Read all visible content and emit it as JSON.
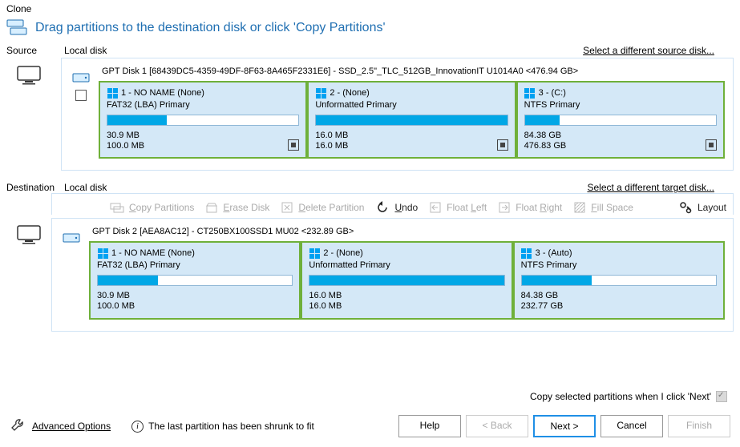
{
  "title": "Clone",
  "header": {
    "hint": "Drag partitions to the destination disk or click 'Copy Partitions'"
  },
  "source": {
    "label": "Source",
    "sublabel": "Local disk",
    "link": "Select a different source disk...",
    "disk": {
      "header": "GPT Disk 1 [68439DC5-4359-49DF-8F63-8A465F2331E6] - SSD_2.5\"_TLC_512GB_InnovationIT U1014A0  <476.94 GB>",
      "partitions": [
        {
          "title": "1 - NO NAME (None)",
          "sub": "FAT32 (LBA) Primary",
          "used": "30.9 MB",
          "total": "100.0 MB",
          "pct": 31,
          "stoppable": true
        },
        {
          "title": "2 -  (None)",
          "sub": "Unformatted Primary",
          "used": "16.0 MB",
          "total": "16.0 MB",
          "pct": 100,
          "stoppable": true
        },
        {
          "title": "3 -  (C:)",
          "sub": "NTFS Primary",
          "used": "84.38 GB",
          "total": "476.83 GB",
          "pct": 18,
          "stoppable": true
        }
      ]
    }
  },
  "dest": {
    "label": "Destination",
    "sublabel": "Local disk",
    "link": "Select a different target disk...",
    "disk": {
      "header": "GPT Disk 2 [AEA8AC12] - CT250BX100SSD1 MU02  <232.89 GB>",
      "partitions": [
        {
          "title": "1 - NO NAME (None)",
          "sub": "FAT32 (LBA) Primary",
          "used": "30.9 MB",
          "total": "100.0 MB",
          "pct": 31,
          "stoppable": false
        },
        {
          "title": "2 -  (None)",
          "sub": "Unformatted Primary",
          "used": "16.0 MB",
          "total": "16.0 MB",
          "pct": 100,
          "stoppable": false
        },
        {
          "title": "3 -  (Auto)",
          "sub": "NTFS Primary",
          "used": "84.38 GB",
          "total": "232.77 GB",
          "pct": 36,
          "stoppable": false
        }
      ]
    }
  },
  "toolbar": {
    "copy": "Copy Partitions",
    "erase": "Erase Disk",
    "delete": "Delete Partition",
    "undo": "Undo",
    "floatleft": "Float Left",
    "floatright": "Float Right",
    "fill": "Fill Space",
    "layout": "Layout"
  },
  "footer": {
    "checkbox_label": "Copy selected partitions when I click 'Next'",
    "advanced": "Advanced Options",
    "status": "The last partition has been shrunk to fit"
  },
  "buttons": {
    "help": "Help",
    "back": "< Back",
    "next": "Next >",
    "cancel": "Cancel",
    "finish": "Finish"
  }
}
